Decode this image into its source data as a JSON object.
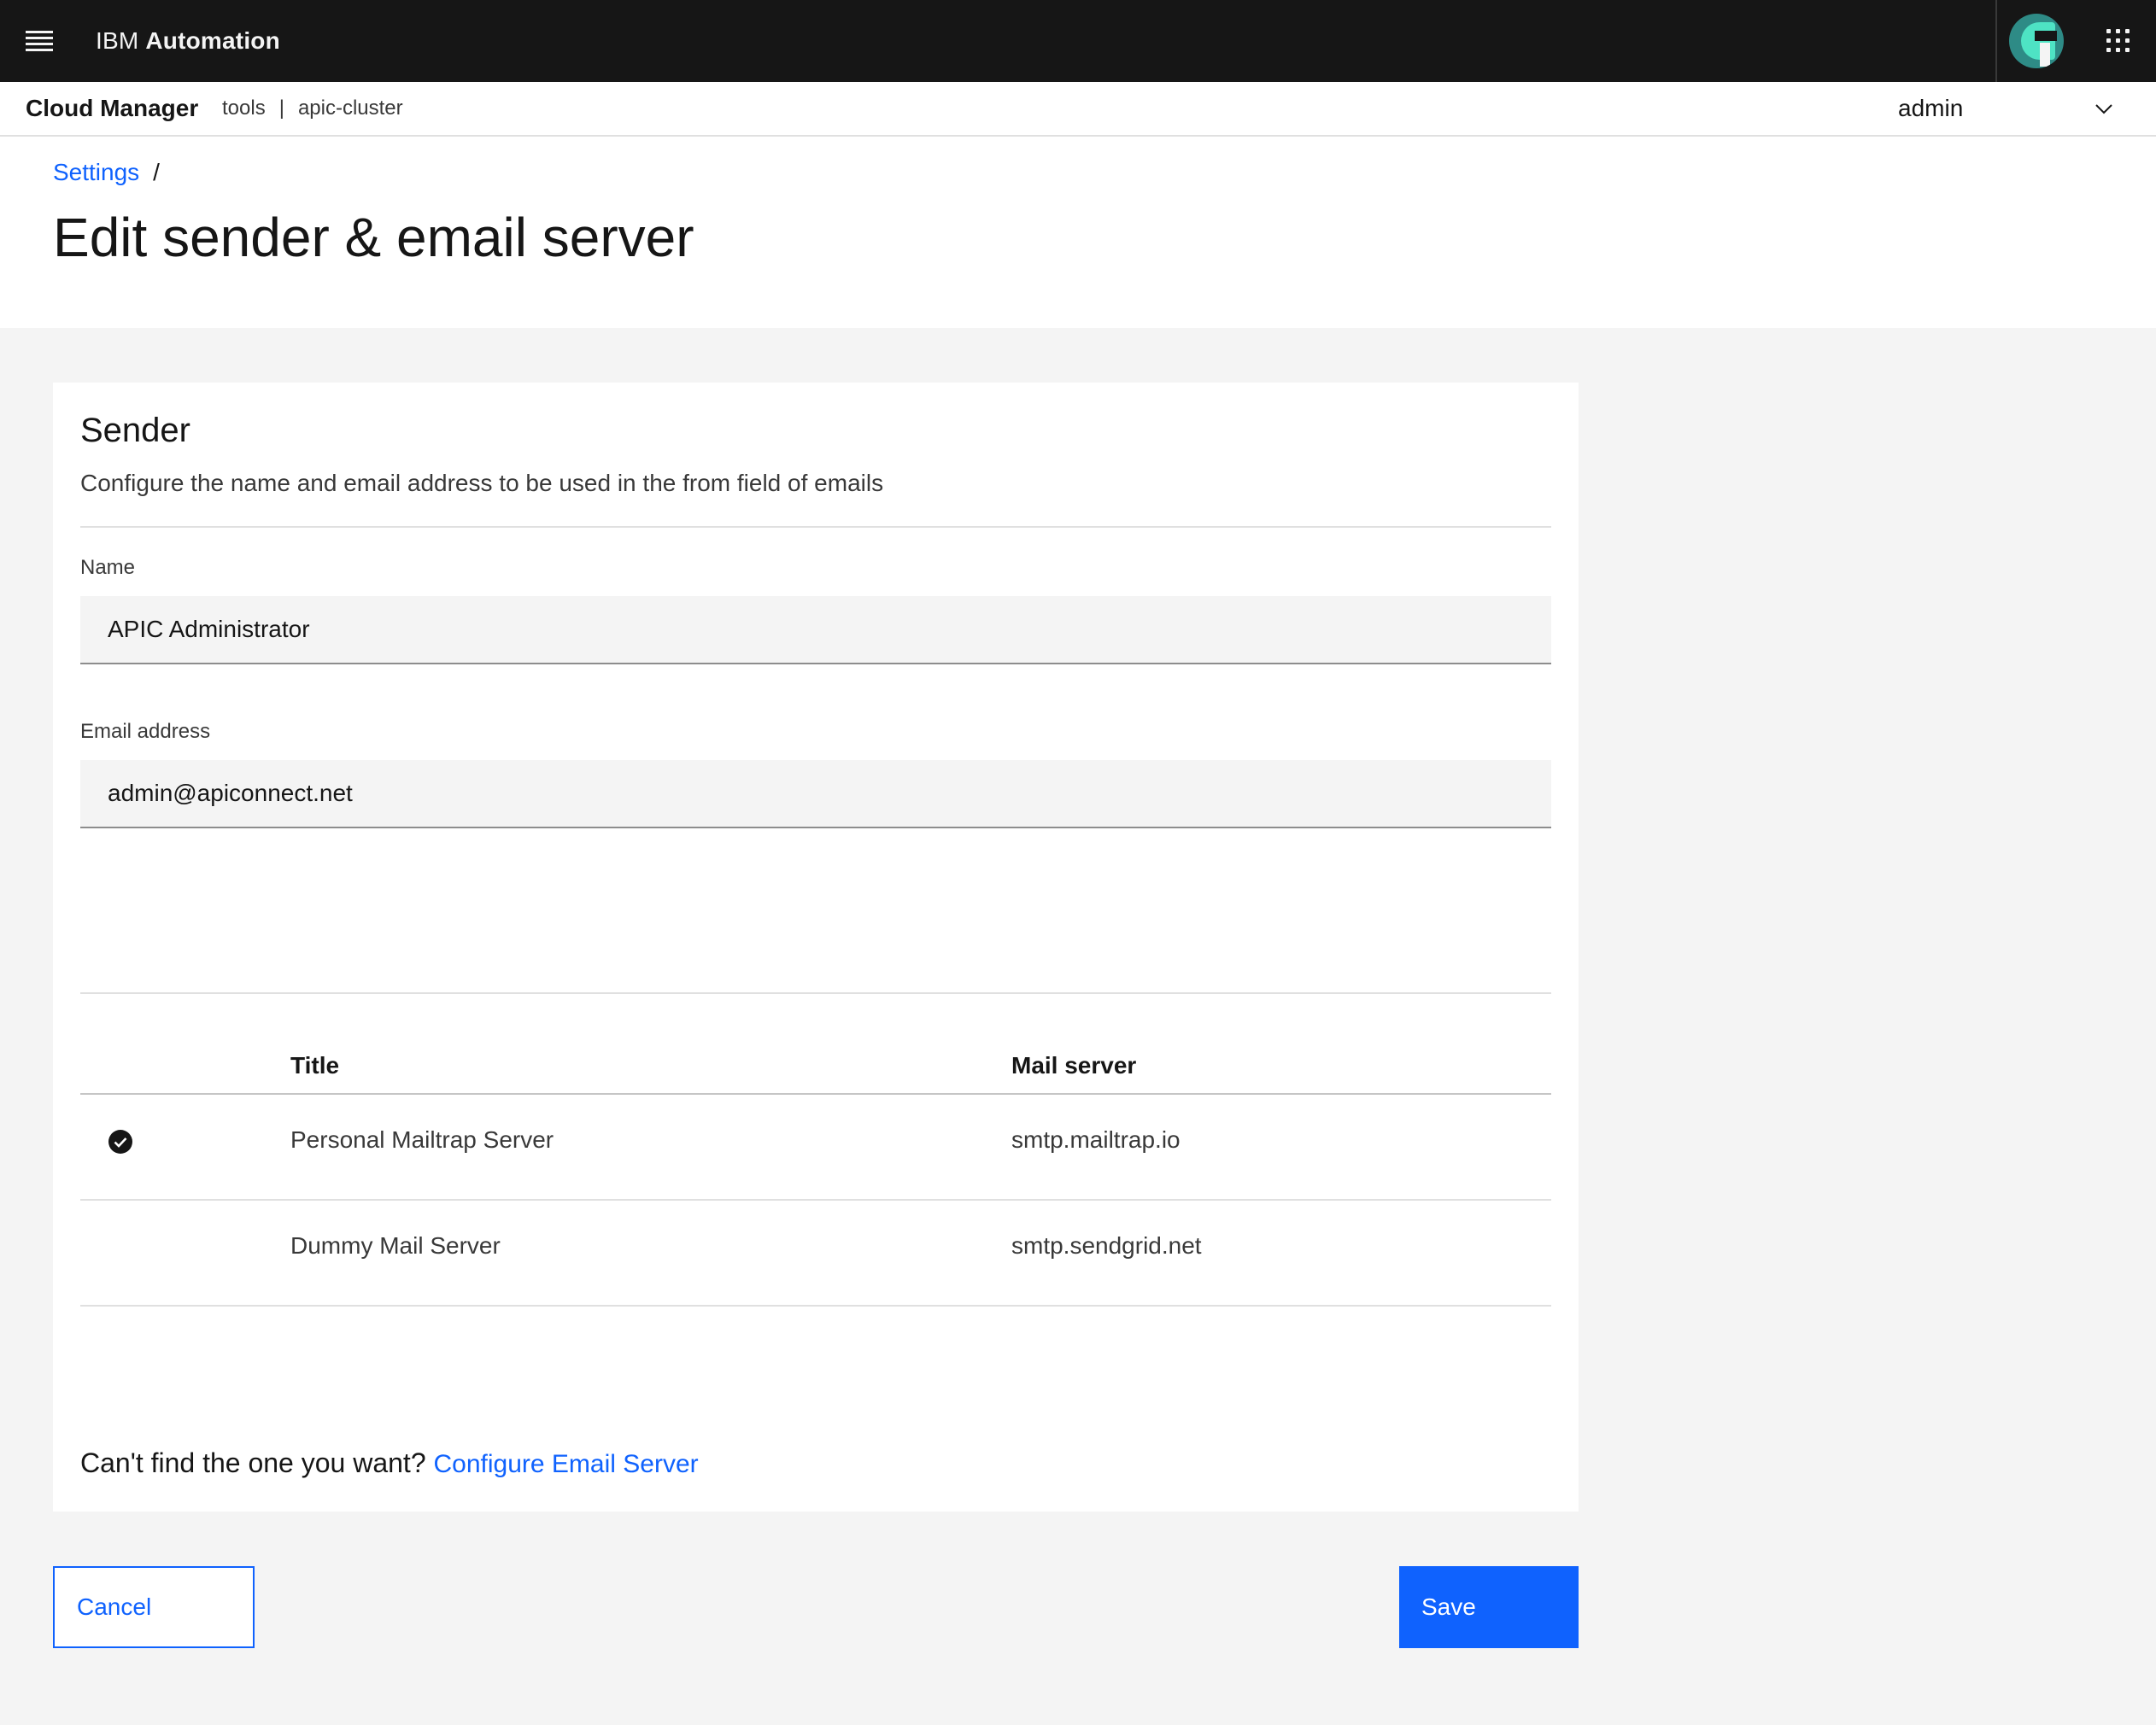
{
  "header": {
    "brand_prefix": "IBM",
    "brand_name": "Automation",
    "colors": {
      "background": "#161616",
      "accent": "#0f62fe"
    },
    "icons": [
      "menu-icon",
      "user-avatar",
      "app-switcher-icon"
    ]
  },
  "subheader": {
    "product": "Cloud Manager",
    "org": "tools",
    "separator": "|",
    "cluster": "apic-cluster",
    "user": "admin"
  },
  "breadcrumb": {
    "settings": "Settings",
    "separator": "/"
  },
  "page": {
    "title": "Edit sender & email server"
  },
  "sender": {
    "heading": "Sender",
    "description": "Configure the name and email address to be used in the from field of emails",
    "name_label": "Name",
    "name_value": "APIC Administrator",
    "email_label": "Email address",
    "email_value": "admin@apiconnect.net"
  },
  "servers_table": {
    "columns": {
      "title": "Title",
      "mail_server": "Mail server"
    },
    "rows": [
      {
        "title": "Personal Mailtrap Server",
        "mail_server": "smtp.mailtrap.io",
        "selected": true
      },
      {
        "title": "Dummy Mail Server",
        "mail_server": "smtp.sendgrid.net",
        "selected": false
      }
    ]
  },
  "footer": {
    "prompt": "Can't find the one you want?",
    "link": "Configure Email Server"
  },
  "actions": {
    "cancel": "Cancel",
    "save": "Save"
  }
}
